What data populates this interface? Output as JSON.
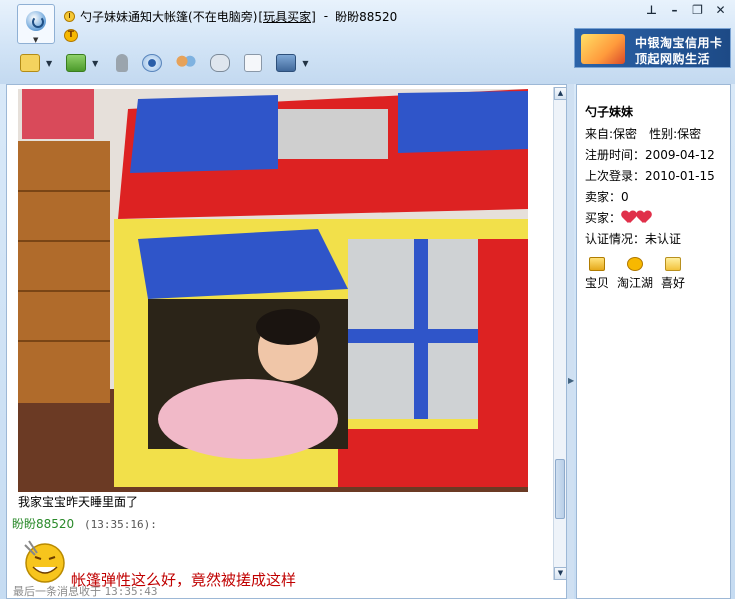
{
  "window": {
    "contact_name": "勺子妹妹通知大帐篷",
    "status_note": "(不在电脑旁)",
    "shop_link": "[玩具买家]",
    "separator": "-",
    "self_name": "盼盼88520",
    "controls": [
      "pin-icon",
      "minimize-icon",
      "restore-icon",
      "close-icon"
    ]
  },
  "ad_banner": {
    "line1": "中银淘宝信用卡",
    "line2": "顶起网购生活"
  },
  "toolbar": {
    "icons": [
      "message-icon",
      "send-file-icon",
      "voice-icon",
      "video-icon",
      "group-icon",
      "game-icon",
      "document-icon",
      "app-icon"
    ]
  },
  "chat": {
    "photo_caption": "我家宝宝昨天睡里面了",
    "message_sender": "盼盼88520",
    "message_time": "(13:35:16):",
    "message_text": "帐篷弹性这么好，竟然被搓成这样",
    "last_message_label": "最后一条消息收于",
    "last_message_time": "13:35:43"
  },
  "profile": {
    "name": "勺子妹妹",
    "origin_label": "来自:",
    "origin_value": "保密",
    "gender_label": "性别:",
    "gender_value": "保密",
    "registered_label": "注册时间：",
    "registered_value": "2009-04-12",
    "last_login_label": "上次登录：",
    "last_login_value": "2010-01-15",
    "seller_label": "卖家：",
    "seller_value": "0",
    "buyer_label": "买家：",
    "buyer_rating": "2 hearts",
    "cert_label": "认证情况：",
    "cert_value": "未认证",
    "links": [
      "宝贝",
      "淘江湖",
      "喜好"
    ]
  },
  "colors": {
    "accent_blue": "#2b62a8",
    "sender_green": "#2a8a2a",
    "message_red": "#c00000"
  }
}
